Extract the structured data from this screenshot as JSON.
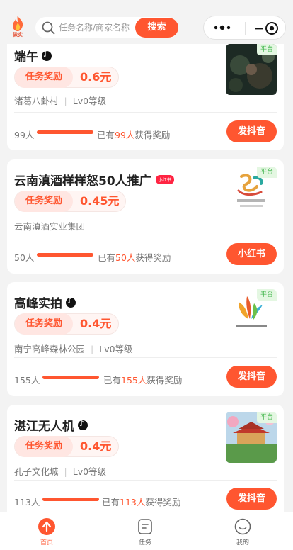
{
  "header": {
    "logo_text": "做实",
    "search_placeholder": "任务名称/商家名称",
    "search_button": "搜索"
  },
  "cards": [
    {
      "title": "端午",
      "reward_label": "任务奖励",
      "reward_amount": "0.6元",
      "sub_left": "诸葛八卦村",
      "sub_right": "Lv0等级",
      "count": "99人",
      "got_prefix": "已有",
      "got_count": "99人",
      "got_suffix": "获得奖励",
      "action": "发抖音",
      "platform_tag": "平台"
    },
    {
      "title": "云南滇酒样样怒50人推广",
      "title_tag": "小红书",
      "reward_label": "任务奖励",
      "reward_amount": "0.45元",
      "sub_left": "云南滇酒实业集团",
      "count": "50人",
      "got_prefix": "已有",
      "got_count": "50人",
      "got_suffix": "获得奖励",
      "action": "小红书",
      "platform_tag": "平台"
    },
    {
      "title": "高峰实拍",
      "reward_label": "任务奖励",
      "reward_amount": "0.4元",
      "sub_left": "南宁高峰森林公园",
      "sub_right": "Lv0等级",
      "count": "155人",
      "got_prefix": "已有",
      "got_count": "155人",
      "got_suffix": "获得奖励",
      "action": "发抖音",
      "platform_tag": "平台"
    },
    {
      "title": "湛江无人机",
      "reward_label": "任务奖励",
      "reward_amount": "0.4元",
      "sub_left": "孔子文化城",
      "sub_right": "Lv0等级",
      "count": "113人",
      "got_prefix": "已有",
      "got_count": "113人",
      "got_suffix": "获得奖励",
      "action": "发抖音",
      "platform_tag": "平台"
    }
  ],
  "nav": {
    "home": "首页",
    "tasks": "任务",
    "mine": "我的"
  },
  "colors": {
    "accent": "#ff5630",
    "platform_green": "#3fb54a"
  }
}
